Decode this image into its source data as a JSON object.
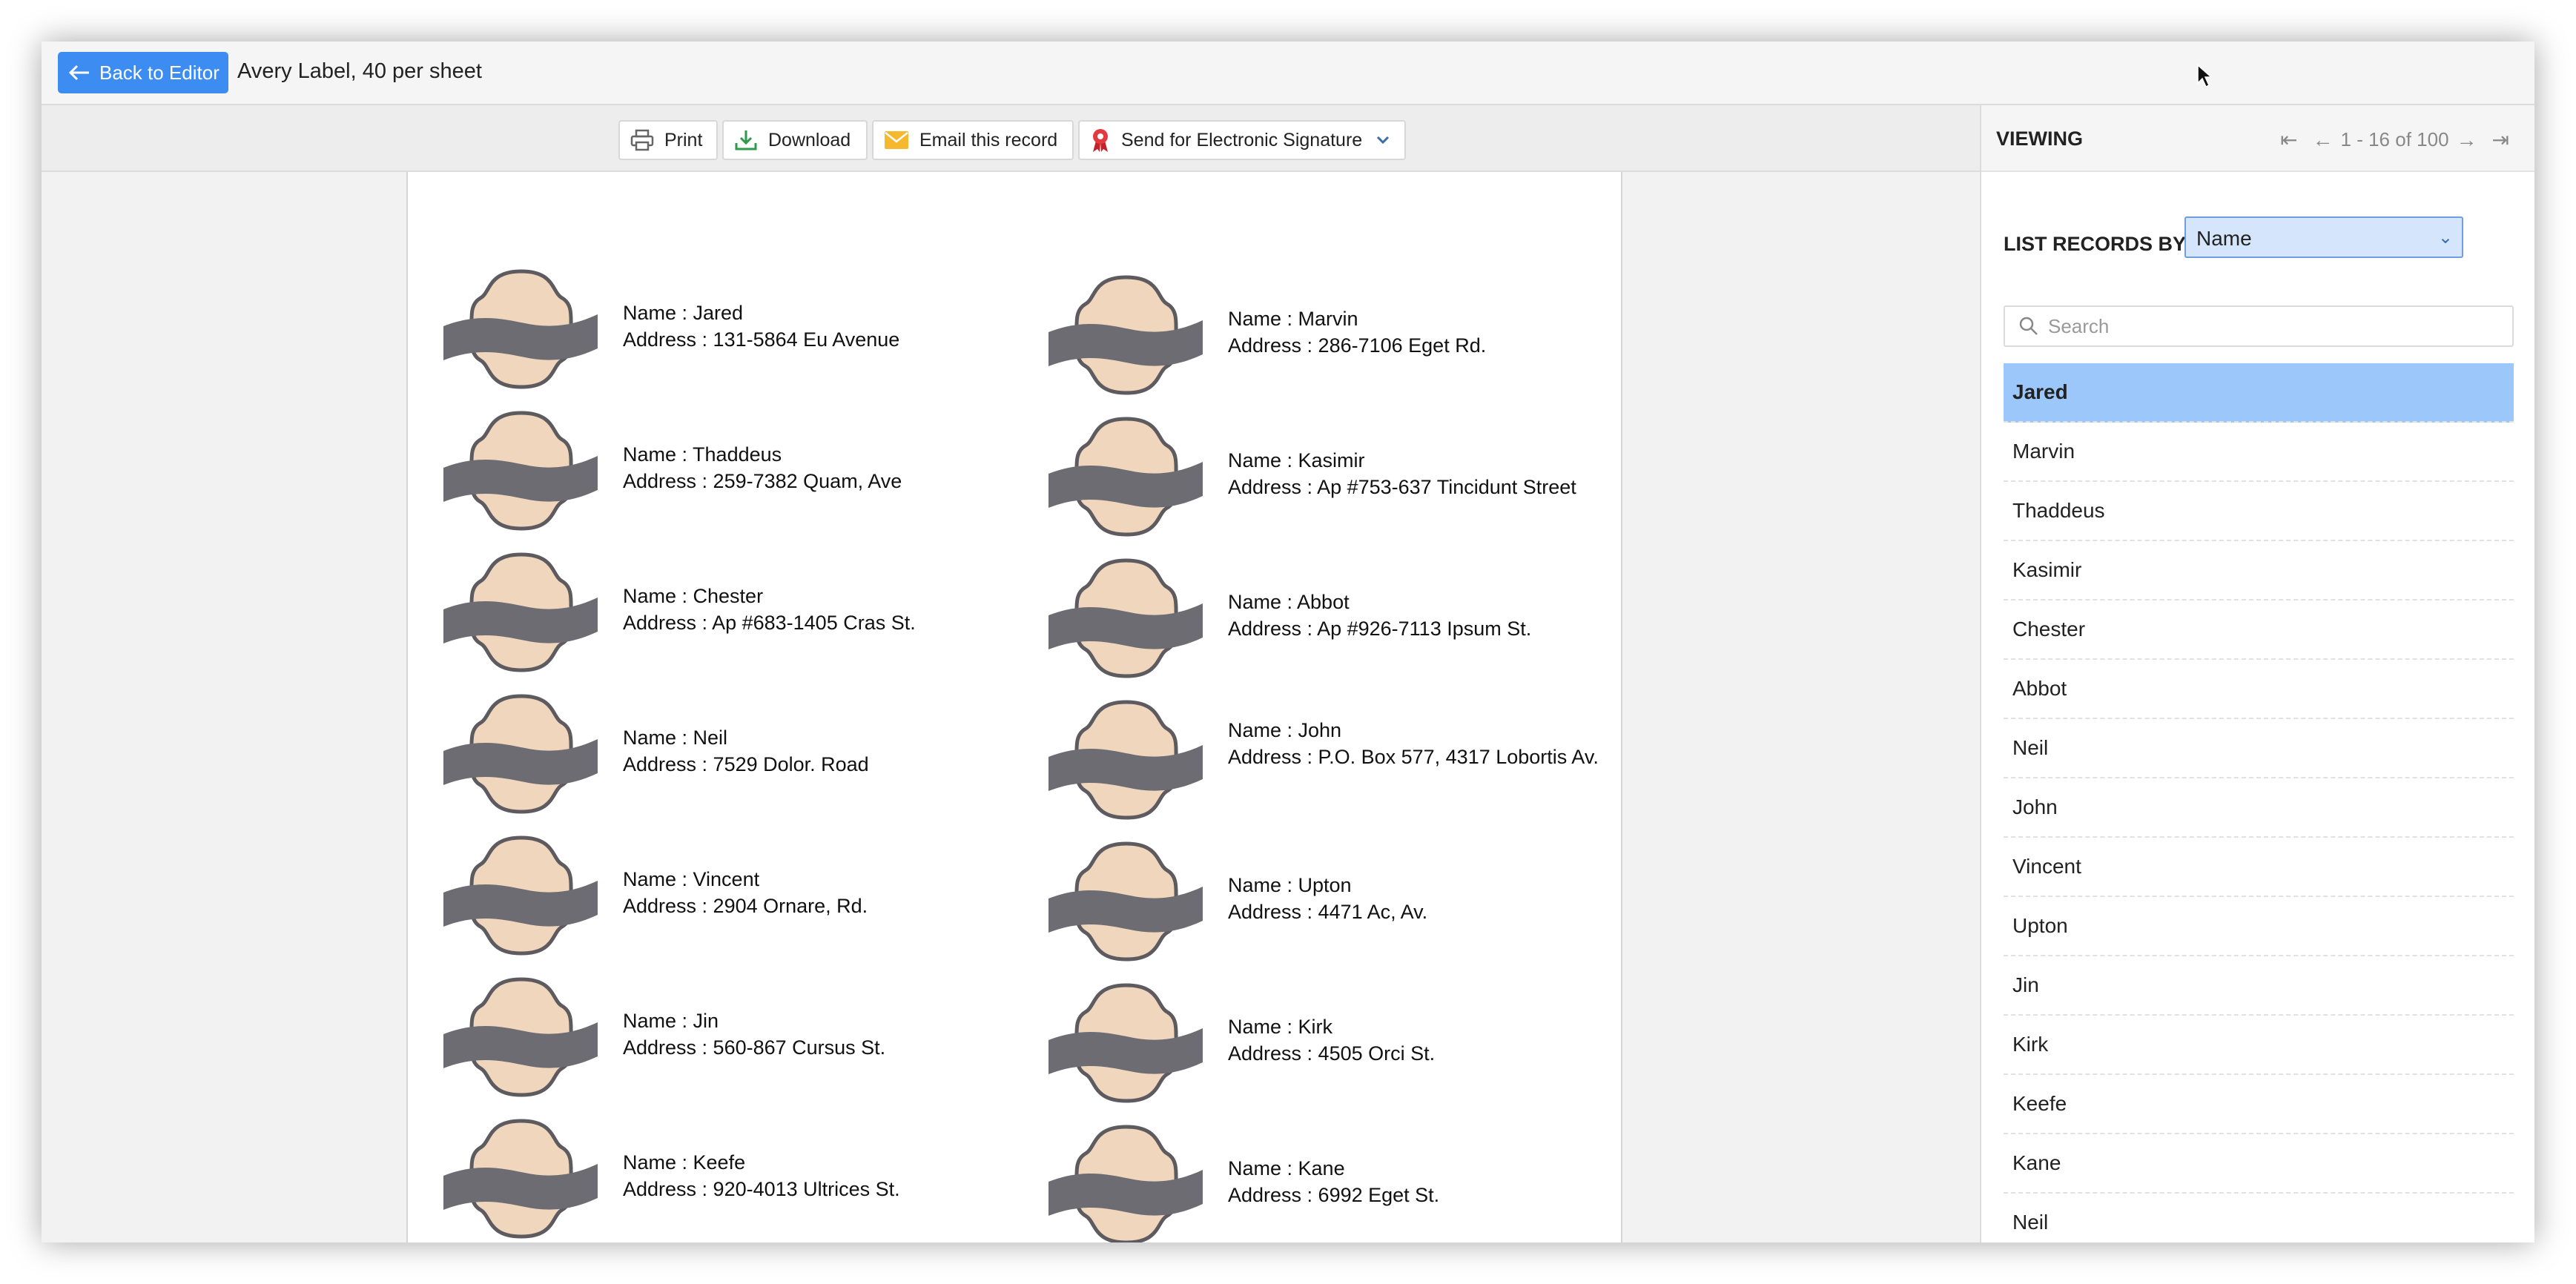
{
  "header": {
    "back_label": "Back to Editor",
    "doc_title": "Avery Label, 40 per sheet"
  },
  "toolbar": {
    "print": "Print",
    "download": "Download",
    "email": "Email this record",
    "signature": "Send for Electronic Signature"
  },
  "labels": [
    {
      "name": "Name : Jared",
      "address": "Address : 131-5864 Eu Avenue"
    },
    {
      "name": "Name : Marvin",
      "address": "Address : 286-7106 Eget Rd."
    },
    {
      "name": "Name : Thaddeus",
      "address": "Address : 259-7382 Quam, Ave"
    },
    {
      "name": "Name : Kasimir",
      "address": "Address : Ap #753-637 Tincidunt Street"
    },
    {
      "name": "Name : Chester",
      "address": "Address : Ap #683-1405 Cras St."
    },
    {
      "name": "Name : Abbot",
      "address": "Address : Ap #926-7113 Ipsum St."
    },
    {
      "name": "Name : Neil",
      "address": "Address : 7529 Dolor. Road"
    },
    {
      "name": "Name : John",
      "address": "Address : P.O. Box 577, 4317 Lobortis Av."
    },
    {
      "name": "Name : Vincent",
      "address": "Address : 2904 Ornare, Rd."
    },
    {
      "name": "Name : Upton",
      "address": "Address : 4471 Ac, Av."
    },
    {
      "name": "Name : Jin",
      "address": "Address : 560-867 Cursus St."
    },
    {
      "name": "Name : Kirk",
      "address": "Address : 4505 Orci St."
    },
    {
      "name": "Name : Keefe",
      "address": "Address : 920-4013 Ultrices St."
    },
    {
      "name": "Name : Kane",
      "address": "Address : 6992 Eget St."
    }
  ],
  "panel": {
    "viewing": "VIEWING",
    "range": "1 - 16 of 100",
    "list_by_label": "LIST RECORDS BY",
    "list_by_value": "Name",
    "search_placeholder": "Search",
    "records": [
      "Jared",
      "Marvin",
      "Thaddeus",
      "Kasimir",
      "Chester",
      "Abbot",
      "Neil",
      "John",
      "Vincent",
      "Upton",
      "Jin",
      "Kirk",
      "Keefe",
      "Kane",
      "Neil"
    ],
    "selected_record": "Jared"
  },
  "colors": {
    "accent": "#3d8cf1",
    "selected_row": "#9cc7fb",
    "badge_fill": "#efd6bd",
    "ribbon": "#6e6c73"
  }
}
